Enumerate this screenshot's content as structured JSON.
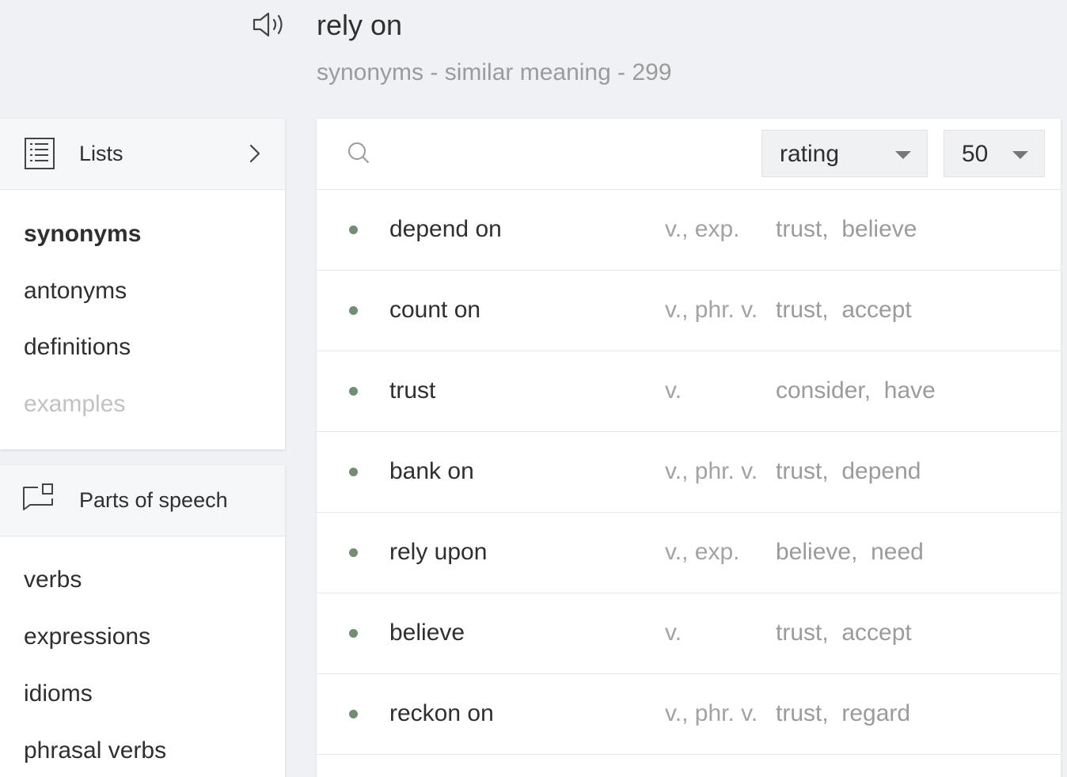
{
  "header": {
    "title": "rely on",
    "subtitle_type": "synonyms",
    "subtitle_meaning": "similar meaning",
    "subtitle_count": "299",
    "separator": " - "
  },
  "sidebar": {
    "lists": {
      "label": "Lists",
      "items": [
        {
          "label": "synonyms",
          "state": "active"
        },
        {
          "label": "antonyms",
          "state": "normal"
        },
        {
          "label": "definitions",
          "state": "normal"
        },
        {
          "label": "examples",
          "state": "disabled"
        }
      ]
    },
    "parts_of_speech": {
      "label": "Parts of speech",
      "items": [
        {
          "label": "verbs"
        },
        {
          "label": "expressions"
        },
        {
          "label": "idioms"
        },
        {
          "label": "phrasal verbs"
        }
      ]
    }
  },
  "toolbar": {
    "search_value": "",
    "sort_value": "rating",
    "count_value": "50"
  },
  "results": [
    {
      "term": "depend on",
      "pos": "v., exp.",
      "related": [
        "trust",
        "believe"
      ]
    },
    {
      "term": "count on",
      "pos": "v., phr. v.",
      "related": [
        "trust",
        "accept"
      ]
    },
    {
      "term": "trust",
      "pos": "v.",
      "related": [
        "consider",
        "have"
      ]
    },
    {
      "term": "bank on",
      "pos": "v., phr. v.",
      "related": [
        "trust",
        "depend"
      ]
    },
    {
      "term": "rely upon",
      "pos": "v., exp.",
      "related": [
        "believe",
        "need"
      ]
    },
    {
      "term": "believe",
      "pos": "v.",
      "related": [
        "trust",
        "accept"
      ]
    },
    {
      "term": "reckon on",
      "pos": "v., phr. v.",
      "related": [
        "trust",
        "regard"
      ]
    }
  ],
  "colors": {
    "background": "#f0f1f4",
    "dot": "#6f8f70",
    "muted_text": "#9b9b9b",
    "disabled_text": "#c2c2c2"
  },
  "icons": {
    "speaker": "speaker-icon",
    "lists": "list-icon",
    "chevron": "chevron-right-icon",
    "parts_of_speech": "speech-bubble-icon",
    "search": "search-icon",
    "caret": "caret-down-icon"
  }
}
